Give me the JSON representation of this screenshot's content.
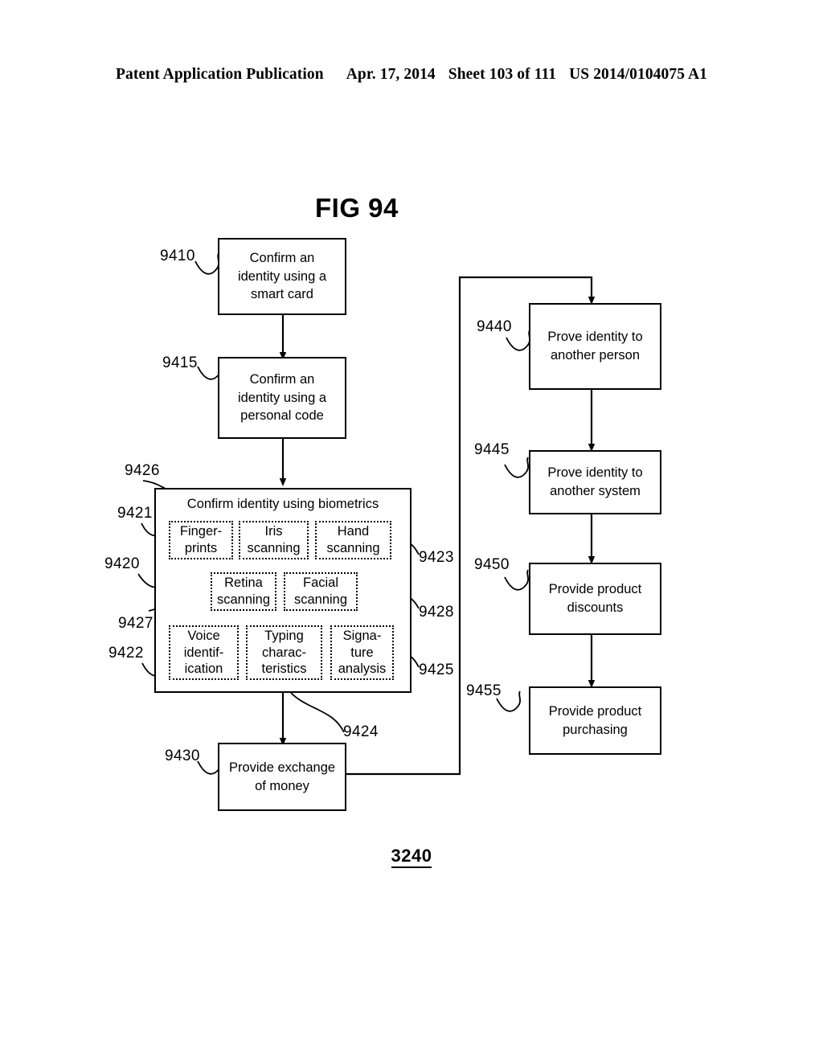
{
  "header": {
    "publication": "Patent Application Publication",
    "date": "Apr. 17, 2014",
    "sheet": "Sheet 103 of 111",
    "patent_number": "US 2014/0104075 A1"
  },
  "figure": {
    "title": "FIG 94",
    "bottom_label": "3240"
  },
  "boxes": {
    "smart_card": {
      "ref": "9410",
      "label": "Confirm an identity using a smart card"
    },
    "personal_code": {
      "ref": "9415",
      "label": "Confirm an identity using a personal code"
    },
    "biometrics": {
      "ref": "9420",
      "label": "Confirm identity using biometrics"
    },
    "exchange_money": {
      "ref": "9430",
      "label": "Provide exchange of money"
    },
    "prove_person": {
      "ref": "9440",
      "label": "Prove identity to another person"
    },
    "prove_system": {
      "ref": "9445",
      "label": "Prove identity to another system"
    },
    "product_discounts": {
      "ref": "9450",
      "label": "Provide product discounts"
    },
    "product_purchasing": {
      "ref": "9455",
      "label": "Provide product purchasing"
    }
  },
  "biometric_items": [
    {
      "ref": "9421",
      "label": "Finger-\nprints"
    },
    {
      "ref": "9426",
      "label": "Iris\nscanning"
    },
    {
      "ref": "9423",
      "label": "Hand\nscanning"
    },
    {
      "ref": "9427",
      "label": "Retina\nscanning"
    },
    {
      "ref": "9428",
      "label": "Facial\nscanning"
    },
    {
      "ref": "9422",
      "label": "Voice\nidentif-\nication"
    },
    {
      "ref": "9424",
      "label": "Typing\ncharac-\nteristics"
    },
    {
      "ref": "9425",
      "label": "Signa-\nture\nanalysis"
    }
  ],
  "biometric_labels": {
    "fingerprints_l1": "Finger-",
    "fingerprints_l2": "prints",
    "iris_l1": "Iris",
    "iris_l2": "scanning",
    "hand_l1": "Hand",
    "hand_l2": "scanning",
    "retina_l1": "Retina",
    "retina_l2": "scanning",
    "facial_l1": "Facial",
    "facial_l2": "scanning",
    "voice_l1": "Voice",
    "voice_l2": "identif-",
    "voice_l3": "ication",
    "typing_l1": "Typing",
    "typing_l2": "charac-",
    "typing_l3": "teristics",
    "signature_l1": "Signa-",
    "signature_l2": "ture",
    "signature_l3": "analysis"
  },
  "box_lines": {
    "smart_card_l1": "Confirm an",
    "smart_card_l2": "identity using a",
    "smart_card_l3": "smart card",
    "personal_code_l1": "Confirm an",
    "personal_code_l2": "identity using a",
    "personal_code_l3": "personal code",
    "biometrics_title": "Confirm identity using biometrics",
    "exchange_l1": "Provide exchange",
    "exchange_l2": "of money",
    "prove_person_l1": "Prove identity to",
    "prove_person_l2": "another person",
    "prove_system_l1": "Prove identity to",
    "prove_system_l2": "another system",
    "discounts_l1": "Provide product",
    "discounts_l2": "discounts",
    "purchasing_l1": "Provide product",
    "purchasing_l2": "purchasing"
  },
  "refs": {
    "r9410": "9410",
    "r9415": "9415",
    "r9420": "9420",
    "r9421": "9421",
    "r9422": "9422",
    "r9423": "9423",
    "r9424": "9424",
    "r9425": "9425",
    "r9426": "9426",
    "r9427": "9427",
    "r9428": "9428",
    "r9430": "9430",
    "r9440": "9440",
    "r9445": "9445",
    "r9450": "9450",
    "r9455": "9455"
  },
  "colors": {
    "ink": "#000000",
    "paper": "#ffffff"
  }
}
